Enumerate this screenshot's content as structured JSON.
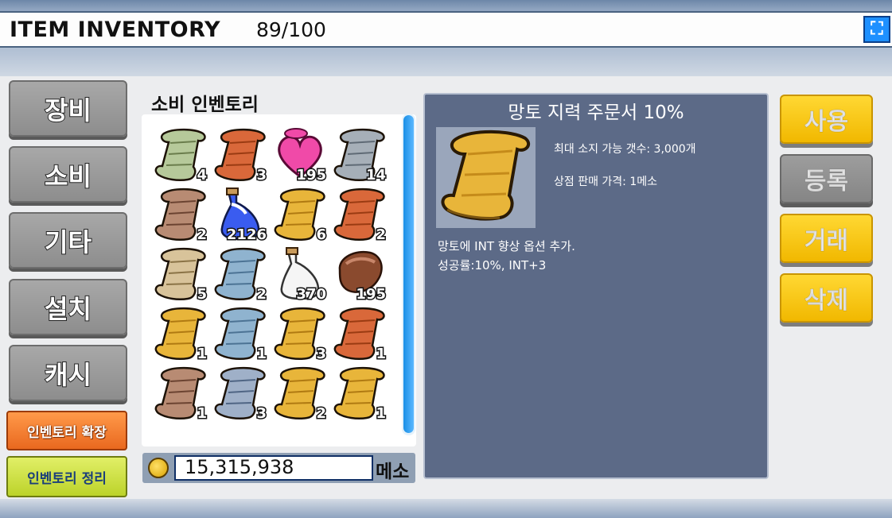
{
  "window": {
    "title": "ITEM INVENTORY",
    "slot_count": "89/100",
    "close_symbol": "⛶"
  },
  "tabs": [
    {
      "label": "장비"
    },
    {
      "label": "소비"
    },
    {
      "label": "기타"
    },
    {
      "label": "설치"
    },
    {
      "label": "캐시"
    }
  ],
  "side_buttons": {
    "expand": "인벤토리 확장",
    "sort": "인벤토리 정리"
  },
  "section_title": "소비 인벤토리",
  "items": [
    {
      "icon": "green-map-scroll-icon",
      "qty": "4"
    },
    {
      "icon": "red-scroll-icon",
      "qty": "3"
    },
    {
      "icon": "pink-heart-potion-icon",
      "qty": "195"
    },
    {
      "icon": "gray-scroll-icon",
      "qty": "14"
    },
    {
      "icon": "brown-map-scroll-icon",
      "qty": "2"
    },
    {
      "icon": "blue-potion-icon",
      "qty": "2126"
    },
    {
      "icon": "yellow-scroll-icon",
      "qty": "6"
    },
    {
      "icon": "red-scroll-icon",
      "qty": "2"
    },
    {
      "icon": "tan-map-scroll-icon",
      "qty": "5"
    },
    {
      "icon": "blue-scroll-icon",
      "qty": "2"
    },
    {
      "icon": "white-potion-icon",
      "qty": "370"
    },
    {
      "icon": "meat-icon",
      "qty": "195"
    },
    {
      "icon": "yellow-scroll-icon",
      "qty": "1"
    },
    {
      "icon": "blue-scroll-icon",
      "qty": "1"
    },
    {
      "icon": "yellow-scroll-icon",
      "qty": "3"
    },
    {
      "icon": "red-scroll-icon",
      "qty": "1"
    },
    {
      "icon": "brown-map-scroll-icon",
      "qty": "1"
    },
    {
      "icon": "blue-map-scroll-icon",
      "qty": "3"
    },
    {
      "icon": "yellow-scroll-icon",
      "qty": "2"
    },
    {
      "icon": "yellow-scroll-icon",
      "qty": "1"
    }
  ],
  "meso": {
    "value": "15,315,938",
    "unit": "메소"
  },
  "detail": {
    "name": "망토 지력 주문서 10%",
    "icon": "yellow-scroll-icon",
    "max_hold": "최대 소지 가능 갯수: 3,000개",
    "sell_price": "상점 판매 가격: 1메소",
    "desc_line1": "망토에 INT 향상 옵션 추가.",
    "desc_line2": "성공률:10%, INT+3"
  },
  "actions": [
    {
      "label": "사용",
      "style": "yellow"
    },
    {
      "label": "등록",
      "style": "gray"
    },
    {
      "label": "거래",
      "style": "yellow"
    },
    {
      "label": "삭제",
      "style": "yellow"
    }
  ],
  "colors": {
    "yellow_scroll": "#e8b53a",
    "red_scroll": "#d9683a",
    "blue_scroll": "#8fb3cf",
    "gray_scroll": "#a6afb8",
    "panel_blue": "#5c6a87",
    "action_yellow": "#ffd022"
  }
}
